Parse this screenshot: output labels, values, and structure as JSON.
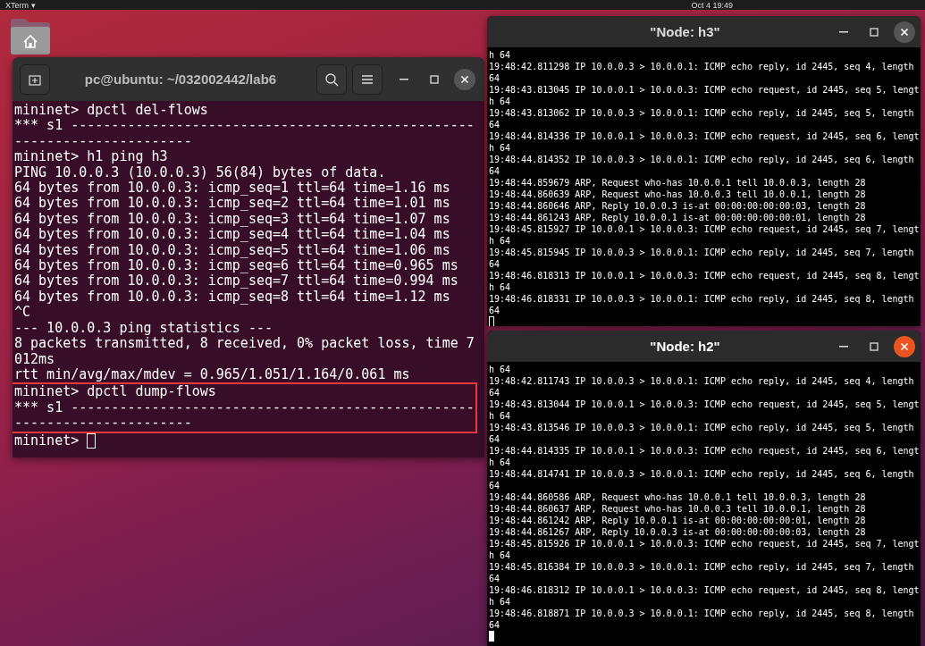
{
  "top_bar": {
    "app_menu": "XTerm ▾",
    "clock": "Oct 4  19:49"
  },
  "desktop": {
    "icons": [
      {
        "kind": "home"
      }
    ]
  },
  "windows": [
    {
      "kind": "gnome-terminal",
      "title": "pc@ubuntu: ~/032002442/lab6",
      "active": false,
      "cursor_prompt": "mininet> ",
      "lines": [
        {
          "text": "mininet> dpctl del-flows",
          "highlighted": false
        },
        {
          "text": "*** s1 --------------------------------------------------",
          "highlighted": false
        },
        {
          "text": "----------------------",
          "highlighted": false
        },
        {
          "text": "mininet> h1 ping h3",
          "highlighted": false
        },
        {
          "text": "PING 10.0.0.3 (10.0.0.3) 56(84) bytes of data.",
          "highlighted": false
        },
        {
          "text": "64 bytes from 10.0.0.3: icmp_seq=1 ttl=64 time=1.16 ms",
          "highlighted": false
        },
        {
          "text": "64 bytes from 10.0.0.3: icmp_seq=2 ttl=64 time=1.01 ms",
          "highlighted": false
        },
        {
          "text": "64 bytes from 10.0.0.3: icmp_seq=3 ttl=64 time=1.07 ms",
          "highlighted": false
        },
        {
          "text": "64 bytes from 10.0.0.3: icmp_seq=4 ttl=64 time=1.04 ms",
          "highlighted": false
        },
        {
          "text": "64 bytes from 10.0.0.3: icmp_seq=5 ttl=64 time=1.06 ms",
          "highlighted": false
        },
        {
          "text": "64 bytes from 10.0.0.3: icmp_seq=6 ttl=64 time=0.965 ms",
          "highlighted": false
        },
        {
          "text": "64 bytes from 10.0.0.3: icmp_seq=7 ttl=64 time=0.994 ms",
          "highlighted": false
        },
        {
          "text": "64 bytes from 10.0.0.3: icmp_seq=8 ttl=64 time=1.12 ms",
          "highlighted": false
        },
        {
          "text": "^C",
          "highlighted": false
        },
        {
          "text": "--- 10.0.0.3 ping statistics ---",
          "highlighted": false
        },
        {
          "text": "8 packets transmitted, 8 received, 0% packet loss, time 7",
          "highlighted": false
        },
        {
          "text": "012ms",
          "highlighted": false
        },
        {
          "text": "rtt min/avg/max/mdev = 0.965/1.051/1.164/0.061 ms",
          "highlighted": false
        },
        {
          "text": "mininet> dpctl dump-flows",
          "highlighted": true
        },
        {
          "text": "*** s1 --------------------------------------------------",
          "highlighted": true
        },
        {
          "text": "----------------------",
          "highlighted": true
        }
      ]
    },
    {
      "kind": "xterm",
      "title": "\"Node: h3\"",
      "active": false,
      "lines": [
        {
          "text": "h 64",
          "highlighted": false
        },
        {
          "text": "19:48:42.811298 IP 10.0.0.3 > 10.0.0.1: ICMP echo reply, id 2445, seq 4, length",
          "highlighted": false
        },
        {
          "text": "64",
          "highlighted": false
        },
        {
          "text": "19:48:43.813045 IP 10.0.0.1 > 10.0.0.3: ICMP echo request, id 2445, seq 5, lengt",
          "highlighted": false
        },
        {
          "text": "h 64",
          "highlighted": false
        },
        {
          "text": "19:48:43.813062 IP 10.0.0.3 > 10.0.0.1: ICMP echo reply, id 2445, seq 5, length",
          "highlighted": false
        },
        {
          "text": "64",
          "highlighted": false
        },
        {
          "text": "19:48:44.814336 IP 10.0.0.1 > 10.0.0.3: ICMP echo request, id 2445, seq 6, lengt",
          "highlighted": false
        },
        {
          "text": "h 64",
          "highlighted": false
        },
        {
          "text": "19:48:44.814352 IP 10.0.0.3 > 10.0.0.1: ICMP echo reply, id 2445, seq 6, length",
          "highlighted": false
        },
        {
          "text": "64",
          "highlighted": false
        },
        {
          "text": "19:48:44.859679 ARP, Request who-has 10.0.0.1 tell 10.0.0.3, length 28",
          "highlighted": false
        },
        {
          "text": "19:48:44.860639 ARP, Request who-has 10.0.0.3 tell 10.0.0.1, length 28",
          "highlighted": false
        },
        {
          "text": "19:48:44.860646 ARP, Reply 10.0.0.3 is-at 00:00:00:00:00:03, length 28",
          "highlighted": false
        },
        {
          "text": "19:48:44.861243 ARP, Reply 10.0.0.1 is-at 00:00:00:00:00:01, length 28",
          "highlighted": false
        },
        {
          "text": "19:48:45.815927 IP 10.0.0.1 > 10.0.0.3: ICMP echo request, id 2445, seq 7, lengt",
          "highlighted": false
        },
        {
          "text": "h 64",
          "highlighted": false
        },
        {
          "text": "19:48:45.815945 IP 10.0.0.3 > 10.0.0.1: ICMP echo reply, id 2445, seq 7, length",
          "highlighted": false
        },
        {
          "text": "64",
          "highlighted": false
        },
        {
          "text": "19:48:46.818313 IP 10.0.0.1 > 10.0.0.3: ICMP echo request, id 2445, seq 8, lengt",
          "highlighted": false
        },
        {
          "text": "h 64",
          "highlighted": false
        },
        {
          "text": "19:48:46.818331 IP 10.0.0.3 > 10.0.0.1: ICMP echo reply, id 2445, seq 8, length",
          "highlighted": false
        },
        {
          "text": "64",
          "highlighted": false
        }
      ]
    },
    {
      "kind": "xterm",
      "title": "\"Node: h2\"",
      "active": true,
      "lines": [
        {
          "text": "h 64",
          "highlighted": false
        },
        {
          "text": "19:48:42.811743 IP 10.0.0.3 > 10.0.0.1: ICMP echo reply, id 2445, seq 4, length",
          "highlighted": false
        },
        {
          "text": "64",
          "highlighted": false
        },
        {
          "text": "19:48:43.813044 IP 10.0.0.1 > 10.0.0.3: ICMP echo request, id 2445, seq 5, lengt",
          "highlighted": false
        },
        {
          "text": "h 64",
          "highlighted": false
        },
        {
          "text": "19:48:43.813546 IP 10.0.0.3 > 10.0.0.1: ICMP echo reply, id 2445, seq 5, length",
          "highlighted": false
        },
        {
          "text": "64",
          "highlighted": false
        },
        {
          "text": "19:48:44.814335 IP 10.0.0.1 > 10.0.0.3: ICMP echo request, id 2445, seq 6, lengt",
          "highlighted": false
        },
        {
          "text": "h 64",
          "highlighted": false
        },
        {
          "text": "19:48:44.814741 IP 10.0.0.3 > 10.0.0.1: ICMP echo reply, id 2445, seq 6, length",
          "highlighted": false
        },
        {
          "text": "64",
          "highlighted": false
        },
        {
          "text": "19:48:44.860586 ARP, Request who-has 10.0.0.1 tell 10.0.0.3, length 28",
          "highlighted": false
        },
        {
          "text": "19:48:44.860637 ARP, Request who-has 10.0.0.3 tell 10.0.0.1, length 28",
          "highlighted": false
        },
        {
          "text": "19:48:44.861242 ARP, Reply 10.0.0.1 is-at 00:00:00:00:00:01, length 28",
          "highlighted": false
        },
        {
          "text": "19:48:44.861267 ARP, Reply 10.0.0.3 is-at 00:00:00:00:00:03, length 28",
          "highlighted": false
        },
        {
          "text": "19:48:45.815926 IP 10.0.0.1 > 10.0.0.3: ICMP echo request, id 2445, seq 7, lengt",
          "highlighted": false
        },
        {
          "text": "h 64",
          "highlighted": false
        },
        {
          "text": "19:48:45.816384 IP 10.0.0.3 > 10.0.0.1: ICMP echo reply, id 2445, seq 7, length",
          "highlighted": false
        },
        {
          "text": "64",
          "highlighted": false
        },
        {
          "text": "19:48:46.818312 IP 10.0.0.1 > 10.0.0.3: ICMP echo request, id 2445, seq 8, lengt",
          "highlighted": false
        },
        {
          "text": "h 64",
          "highlighted": false
        },
        {
          "text": "19:48:46.818871 IP 10.0.0.3 > 10.0.0.1: ICMP echo reply, id 2445, seq 8, length",
          "highlighted": false
        },
        {
          "text": "64",
          "highlighted": false
        }
      ]
    }
  ]
}
